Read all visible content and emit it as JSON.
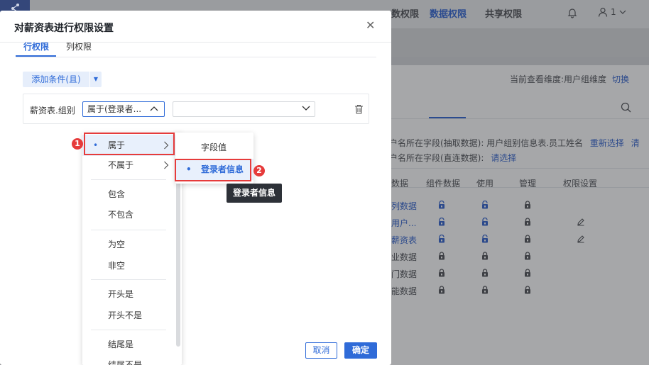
{
  "background": {
    "user_count": "1",
    "current_dimension_text": "当前查看维度:用户组维度",
    "switch_link": "切换",
    "tabs": [
      "数权限",
      "数据权限",
      "共享权限"
    ],
    "field_line1_prefix": "户名所在字段(抽取数据): 用户组别信息表.员工姓名",
    "field_line1_link": "重新选择",
    "field_line1_more": "清",
    "field_line2_prefix": "户名所在字段(直连数据):",
    "field_line2_link": "请选择",
    "table_headers": [
      "数据",
      "组件数据",
      "使用",
      "管理",
      "权限设置"
    ],
    "rows": [
      {
        "name": "列数据",
        "blue": true
      },
      {
        "name": "用户...",
        "blue": true
      },
      {
        "name": "薪资表",
        "blue": true
      },
      {
        "name": "业数据",
        "blue": false
      },
      {
        "name": "门数据",
        "blue": false
      },
      {
        "name": "能数据",
        "blue": false
      }
    ]
  },
  "dialog": {
    "title": "对薪资表进行权限设置",
    "tab_row": "行权限",
    "tab_col": "列权限",
    "add_condition": "添加条件(且)",
    "condition_field": "薪资表.组别",
    "operator_value": "属于(登录者...",
    "value_select": "",
    "cancel": "取消",
    "ok": "确定"
  },
  "menu": {
    "items": [
      "属于",
      "不属于",
      "包含",
      "不包含",
      "为空",
      "非空",
      "开头是",
      "开头不是",
      "结尾是",
      "结尾不是"
    ],
    "selected": "属于"
  },
  "submenu": {
    "items": [
      "字段值",
      "登录者信息"
    ],
    "selected": "登录者信息"
  },
  "tooltip": "登录者信息",
  "annotations": {
    "badge1": "1",
    "badge2": "2"
  },
  "colors": {
    "accent": "#2f6bd8",
    "highlight": "#e63b3b"
  }
}
